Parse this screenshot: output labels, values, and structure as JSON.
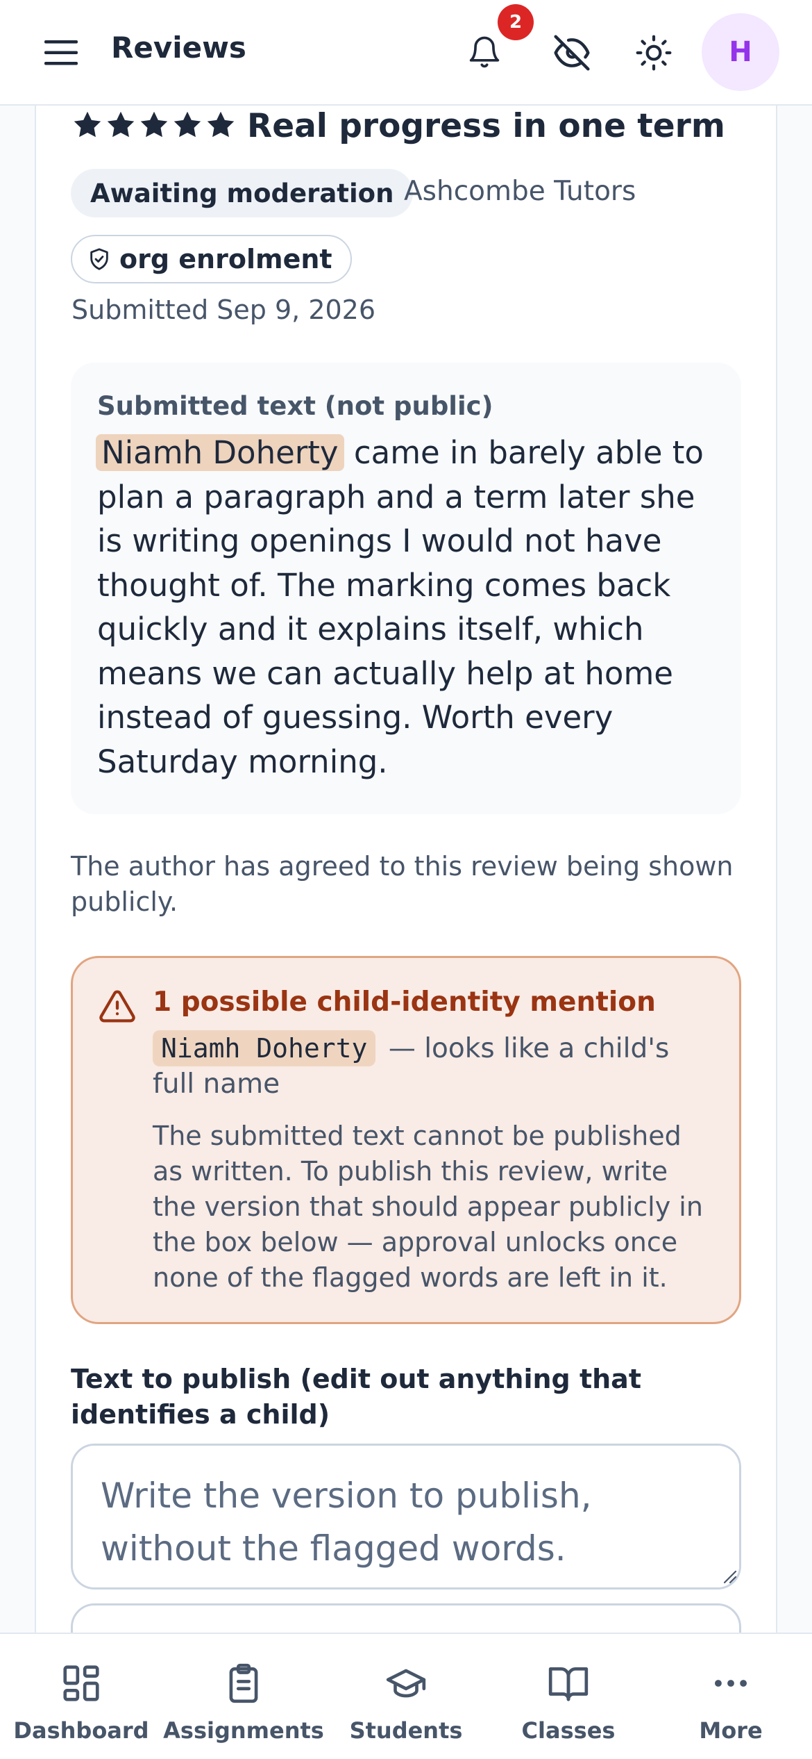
{
  "header": {
    "title": "Reviews",
    "notification_count": "2",
    "avatar_initial": "H"
  },
  "review": {
    "rating": 5,
    "title": "Real progress in one term",
    "status": "Awaiting moderation",
    "organisation": "Ashcombe Tutors",
    "source": "org enrolment",
    "submitted": "Submitted Sep 9, 2026",
    "submitted_label": "Submitted text (not public)",
    "flagged_name": "Niamh Doherty",
    "body_rest": " came in barely able to plan a paragraph and a term later she is writing openings I would not have thought of. The marking comes back quickly and it explains itself, which means we can actually help at home instead of guessing. Worth every Saturday morning.",
    "consent": "The author has agreed to this review being shown publicly."
  },
  "warning": {
    "title": "1 possible child-identity mention",
    "flag_word": "Niamh Doherty",
    "flag_reason": "— looks like a child's full name",
    "body": "The submitted text cannot be published as written. To publish this review, write the version that should appear publicly in the box below — approval unlocks once none of the flagged words are left in it."
  },
  "publish": {
    "label": "Text to publish (edit out anything that identifies a child)",
    "placeholder": "Write the version to publish, without the flagged words.",
    "value": ""
  },
  "bottom_nav": [
    {
      "label": "Dashboard",
      "icon": "dashboard-icon"
    },
    {
      "label": "Assignments",
      "icon": "clipboard-icon"
    },
    {
      "label": "Students",
      "icon": "graduation-cap-icon"
    },
    {
      "label": "Classes",
      "icon": "book-open-icon"
    },
    {
      "label": "More",
      "icon": "more-dots-icon"
    }
  ],
  "colors": {
    "accent": "#9333ea",
    "badge": "#dc2626",
    "warning_bg": "#f9ebe5",
    "warning_border": "#e0a582",
    "warning_text": "#9a3412"
  }
}
